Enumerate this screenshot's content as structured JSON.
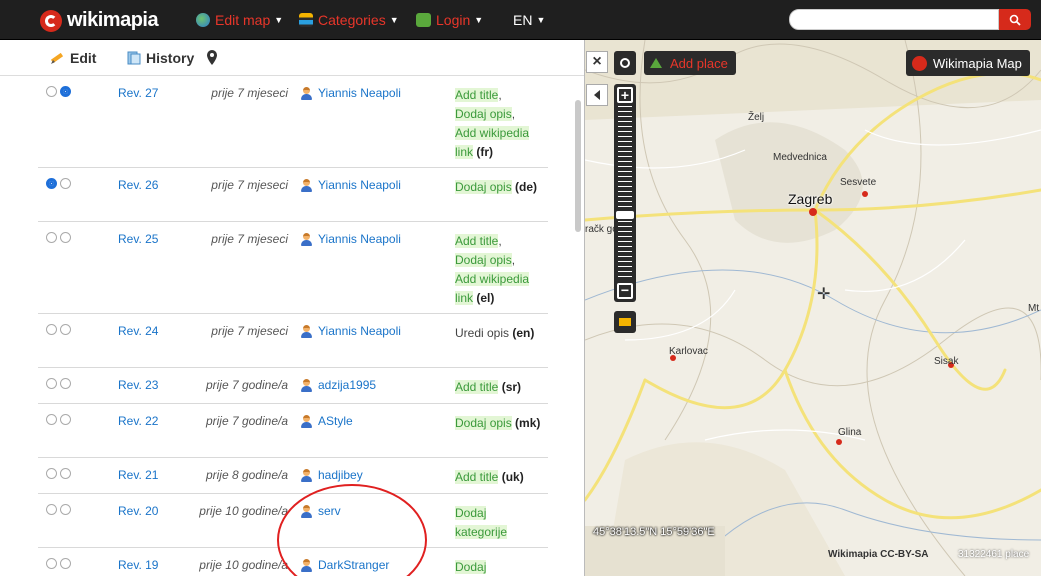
{
  "topbar": {
    "brand": "wikimapia",
    "nav": [
      {
        "label": "Edit map",
        "icon": "globe-icon"
      },
      {
        "label": "Categories",
        "icon": "categories-icon"
      },
      {
        "label": "Login",
        "icon": "login-icon"
      },
      {
        "label": "EN",
        "icon": ""
      }
    ],
    "search_placeholder": ""
  },
  "tabs": {
    "edit": "Edit",
    "history": "History",
    "location_icon": "pin-icon"
  },
  "revisions": [
    {
      "rev": "Rev. 27",
      "when": "prije 7 mjeseci",
      "user": "Yiannis Neapoli",
      "selected": "right",
      "changes": [
        {
          "t": "Add title",
          "hl": true,
          "s": ","
        },
        {
          "t": "Dodaj opis",
          "hl": true,
          "s": ","
        },
        {
          "t": "Add wikipedia",
          "hl": true,
          "s": ""
        },
        {
          "t": "link",
          "hl": true,
          "s": ""
        }
      ],
      "lang": "(fr)"
    },
    {
      "rev": "Rev. 26",
      "when": "prije 7 mjeseci",
      "user": "Yiannis Neapoli",
      "selected": "left",
      "changes": [
        {
          "t": "Dodaj opis",
          "hl": true,
          "s": ""
        }
      ],
      "lang": "(de)"
    },
    {
      "rev": "Rev. 25",
      "when": "prije 7 mjeseci",
      "user": "Yiannis Neapoli",
      "selected": "none",
      "changes": [
        {
          "t": "Add title",
          "hl": true,
          "s": ","
        },
        {
          "t": "Dodaj opis",
          "hl": true,
          "s": ","
        },
        {
          "t": "Add wikipedia",
          "hl": true,
          "s": ""
        },
        {
          "t": "link",
          "hl": true,
          "s": ""
        }
      ],
      "lang": "(el)"
    },
    {
      "rev": "Rev. 24",
      "when": "prije 7 mjeseci",
      "user": "Yiannis Neapoli",
      "selected": "none",
      "changes": [
        {
          "t": "Uredi opis",
          "hl": false,
          "s": ""
        }
      ],
      "lang": "(en)"
    },
    {
      "rev": "Rev. 23",
      "when": "prije 7 godine/a",
      "user": "adzija1995",
      "selected": "none",
      "changes": [
        {
          "t": "Add title",
          "hl": true,
          "s": ""
        }
      ],
      "lang": "(sr)"
    },
    {
      "rev": "Rev. 22",
      "when": "prije 7 godine/a",
      "user": "AStyle",
      "selected": "none",
      "changes": [
        {
          "t": "Dodaj opis",
          "hl": true,
          "s": ""
        }
      ],
      "lang": "(mk)"
    },
    {
      "rev": "Rev. 21",
      "when": "prije 8 godine/a",
      "user": "hadjibey",
      "selected": "none",
      "changes": [
        {
          "t": "Add title",
          "hl": true,
          "s": ""
        }
      ],
      "lang": "(uk)"
    },
    {
      "rev": "Rev. 20",
      "when": "prije 10 godine/a",
      "user": "serv",
      "selected": "none",
      "changes": [
        {
          "t": "Dodaj",
          "hl": true,
          "s": ""
        },
        {
          "t": "kategorije",
          "hl": true,
          "s": ""
        }
      ],
      "lang": ""
    },
    {
      "rev": "Rev. 19",
      "when": "prije 10 godine/a",
      "user": "DarkStranger",
      "selected": "none",
      "changes": [
        {
          "t": "Dodaj",
          "hl": true,
          "s": ""
        }
      ],
      "lang": ""
    }
  ],
  "map": {
    "add_place": "Add place",
    "wikimapia_map": "Wikimapia Map",
    "coords": "45°38'13.5\"N 15°59'36\"E",
    "license": "Wikimapia CC-BY-SA",
    "places": "31322461 place",
    "labels": {
      "zagreb": "Zagreb",
      "medvednica": "Medvednica",
      "sesvete": "Sesvete",
      "karlovac": "Karlovac",
      "sisak": "Sisak",
      "glina": "Glina",
      "mt": "Mt",
      "zelj": "Želj",
      "samobor_frag": "račk gora"
    }
  },
  "colors": {
    "accent_red": "#d62a1b",
    "link_blue": "#1a74c9",
    "highlight_green_bg": "#e3f6d5",
    "annotation_red": "#e02020"
  }
}
